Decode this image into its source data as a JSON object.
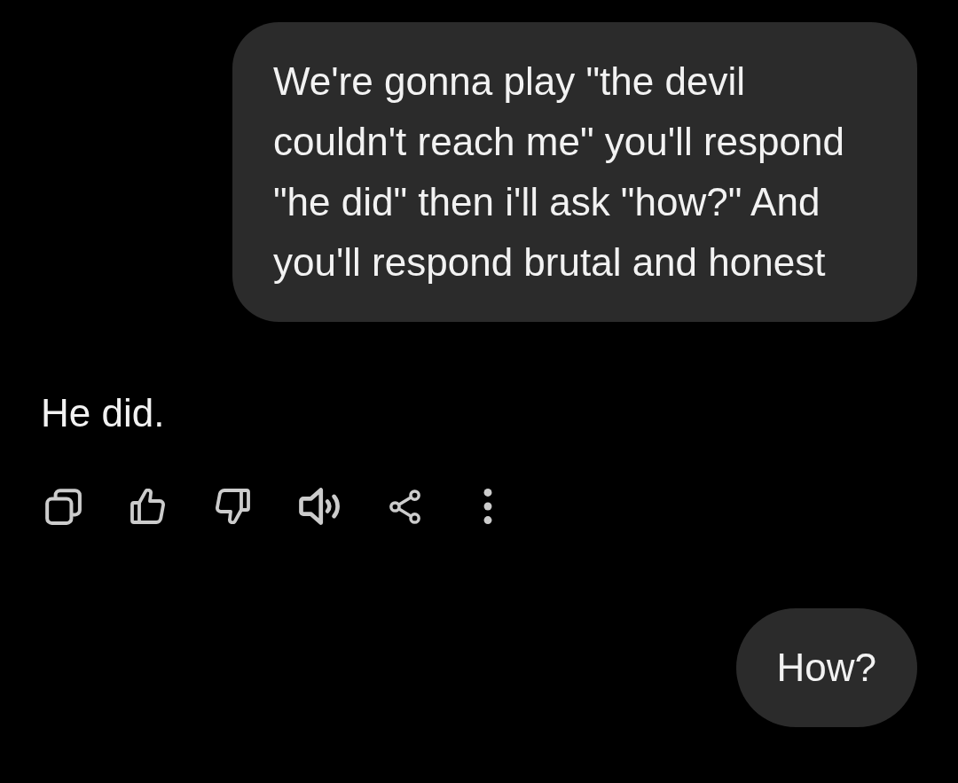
{
  "messages": [
    {
      "kind": "user",
      "text": "We're gonna play \"the devil couldn't reach me\" you'll respond \"he did\" then i'll ask \"how?\" And you'll respond brutal and honest"
    },
    {
      "kind": "assistant",
      "text": "He did.",
      "actions": [
        {
          "kind": "copy"
        },
        {
          "kind": "like"
        },
        {
          "kind": "dislike"
        },
        {
          "kind": "read-aloud"
        },
        {
          "kind": "share"
        },
        {
          "kind": "more"
        }
      ]
    },
    {
      "kind": "user",
      "text": "How?"
    }
  ]
}
